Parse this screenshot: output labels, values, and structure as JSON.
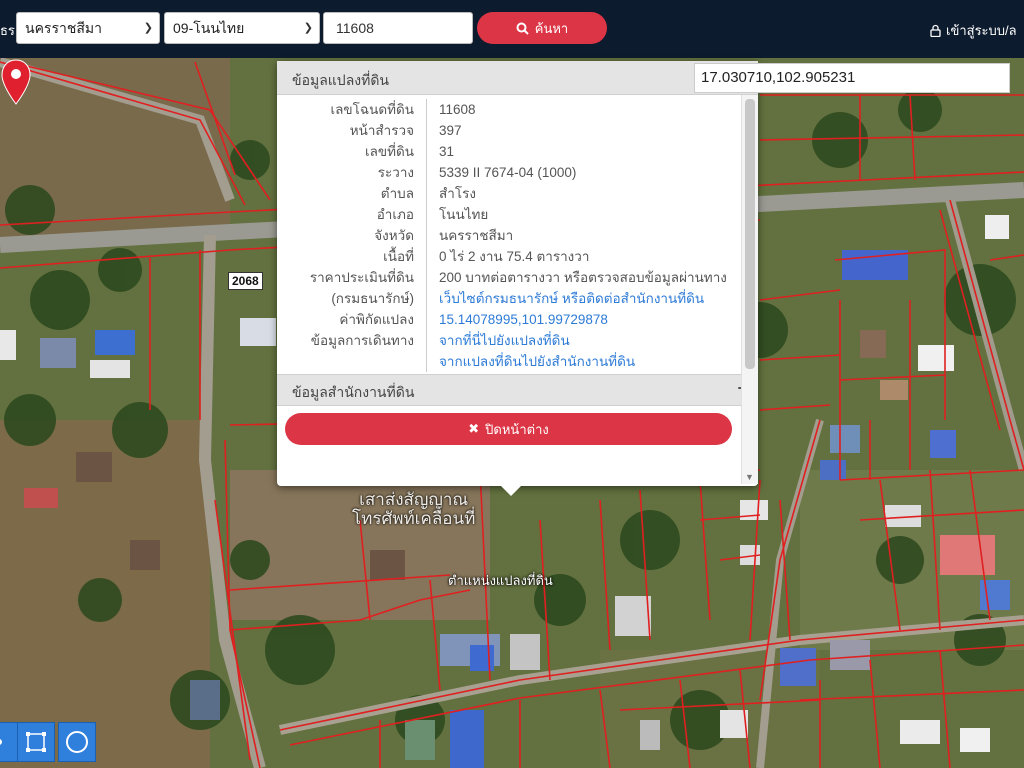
{
  "topbar": {
    "label_fragment": "ธร",
    "province": "นครราชสีมา",
    "district": "09-โนนไทย",
    "deed_number": "11608",
    "search_label": "ค้นหา",
    "login_label": "เข้าสู่ระบบ/ล"
  },
  "map": {
    "road_number": "2068",
    "poi_line1": "เสาส่งสัญญาณ",
    "poi_line2": "โทรศัพท์เคลื่อนที่",
    "pin_label": "ตำแหน่งแปลงที่ดิน"
  },
  "coordinate_box": "17.030710,102.905231",
  "popup": {
    "title": "ข้อมูลแปลงที่ดิน",
    "rows": [
      {
        "key": "เลขโฉนดที่ดิน",
        "value": "11608"
      },
      {
        "key": "หน้าสำรวจ",
        "value": "397"
      },
      {
        "key": "เลขที่ดิน",
        "value": "31"
      },
      {
        "key": "ระวาง",
        "value": "5339 II 7674-04 (1000)"
      },
      {
        "key": "ตำบล",
        "value": "สำโรง"
      },
      {
        "key": "อำเภอ",
        "value": "โนนไทย"
      },
      {
        "key": "จังหวัด",
        "value": "นครราชสีมา"
      },
      {
        "key": "เนื้อที่",
        "value": "0 ไร่ 2 งาน 75.4 ตารางวา"
      },
      {
        "key": "ราคาประเมินที่ดิน",
        "value": "200 บาทต่อตารางวา หรือตรวจสอบข้อมูลผ่านทาง"
      },
      {
        "key": "(กรมธนารักษ์)",
        "value": "เว็บไซต์กรมธนารักษ์ หรือติดต่อสำนักงานที่ดิน"
      },
      {
        "key": "ค่าพิกัดแปลง",
        "value": "15.14078995,101.99729878"
      },
      {
        "key": "ข้อมูลการเดินทาง",
        "value": "จากที่นี่ไปยังแปลงที่ดิน"
      },
      {
        "key": "",
        "value": "จากแปลงที่ดินไปยังสำนักงานที่ดิน"
      }
    ],
    "office_section": "ข้อมูลสำนักงานที่ดิน",
    "close_label": "ปิดหน้าต่าง"
  },
  "colors": {
    "topbar": "#0d1b2e",
    "accent_red": "#dc3545",
    "link_blue": "#2e7bd6",
    "parcel_line": "#e02020",
    "tool_blue": "#2f7fdc"
  },
  "icons": {
    "search": "search-icon",
    "lock": "lock-icon",
    "close": "close-x-icon",
    "plus": "plus-icon",
    "pin": "map-pin-icon"
  }
}
